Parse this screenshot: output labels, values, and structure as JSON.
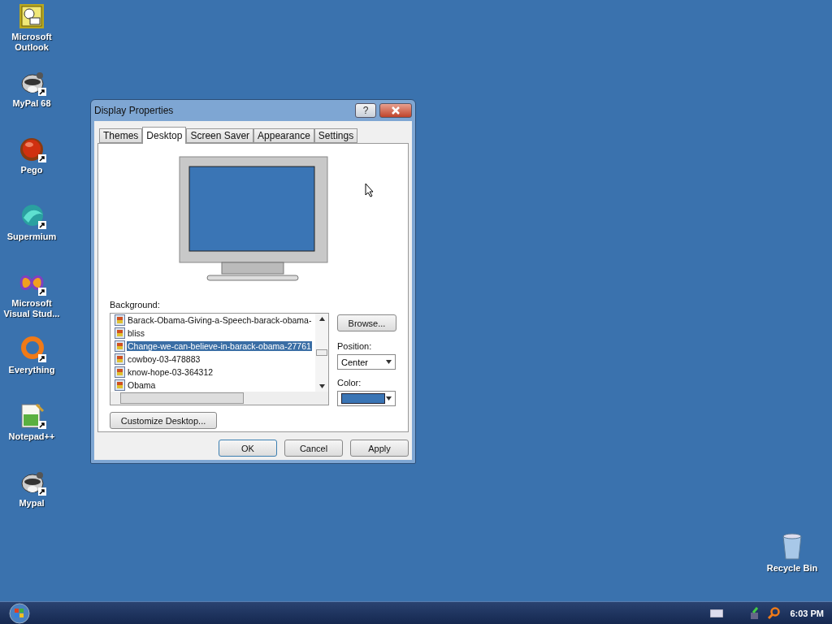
{
  "desktop_icons": [
    {
      "label": "Microsoft Outlook",
      "shortcut": false
    },
    {
      "label": "MyPal 68",
      "shortcut": true
    },
    {
      "label": "Pego",
      "shortcut": true
    },
    {
      "label": "Supermium",
      "shortcut": true
    },
    {
      "label": "Microsoft Visual Stud...",
      "shortcut": true
    },
    {
      "label": "Everything",
      "shortcut": true
    },
    {
      "label": "Notepad++",
      "shortcut": true
    },
    {
      "label": "Mypal",
      "shortcut": true
    }
  ],
  "recycle_bin": {
    "label": "Recycle Bin"
  },
  "window": {
    "title": "Display Properties",
    "help": "?",
    "tabs": [
      {
        "label": "Themes",
        "selected": false
      },
      {
        "label": "Desktop",
        "selected": true
      },
      {
        "label": "Screen Saver",
        "selected": false
      },
      {
        "label": "Appearance",
        "selected": false
      },
      {
        "label": "Settings",
        "selected": false
      }
    ],
    "background_label": "Background:",
    "backgrounds": [
      {
        "name": "Barack-Obama-Giving-a-Speech-barack-obama-",
        "selected": false
      },
      {
        "name": "bliss",
        "selected": false
      },
      {
        "name": "Change-we-can-believe-in-barack-obama-27761",
        "selected": true
      },
      {
        "name": "cowboy-03-478883",
        "selected": false
      },
      {
        "name": "know-hope-03-364312",
        "selected": false
      },
      {
        "name": "Obama",
        "selected": false
      }
    ],
    "browse_button": "Browse...",
    "position_label": "Position:",
    "position_value": "Center",
    "color_label": "Color:",
    "color": "#3a75b5",
    "customize_button": "Customize Desktop...",
    "buttons": [
      "OK",
      "Cancel",
      "Apply"
    ]
  },
  "taskbar": {
    "clock": "6:03 PM"
  }
}
